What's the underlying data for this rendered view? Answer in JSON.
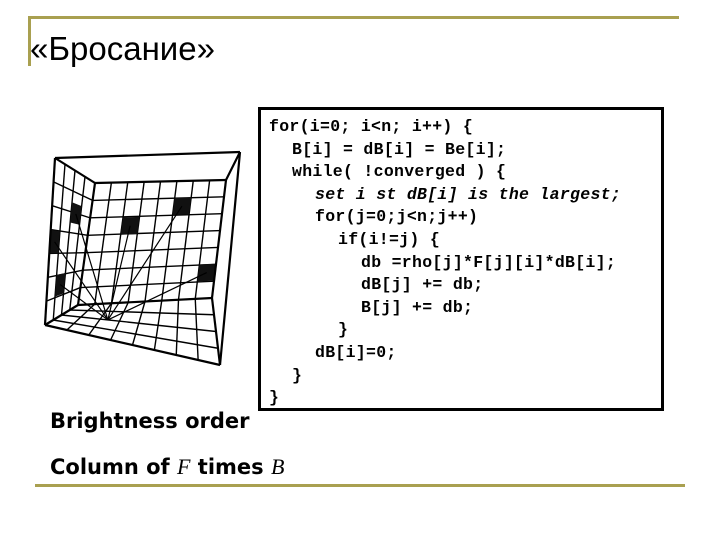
{
  "slide": {
    "title": "«Бросание»",
    "accent_color": "#a9a050"
  },
  "code": {
    "lines": [
      {
        "indent": 0,
        "text": "for(i=0; i<n; i++) {",
        "italic": false
      },
      {
        "indent": 1,
        "text": "B[i] = dB[i] = Be[i];",
        "italic": false
      },
      {
        "indent": 1,
        "text": "while( !converged ) {",
        "italic": false
      },
      {
        "indent": 2,
        "text": "set i st dB[i] is the largest;",
        "italic": true
      },
      {
        "indent": 2,
        "text": "for(j=0;j<n;j++)",
        "italic": false
      },
      {
        "indent": 3,
        "text": "if(i!=j) {",
        "italic": false
      },
      {
        "indent": 4,
        "text": "db =rho[j]*F[j][i]*dB[i];",
        "italic": false
      },
      {
        "indent": 4,
        "text": "dB[j] += db;",
        "italic": false
      },
      {
        "indent": 4,
        "text": "B[j] += db;",
        "italic": false
      },
      {
        "indent": 3,
        "text": "}",
        "italic": false
      },
      {
        "indent": 2,
        "text": "dB[i]=0;",
        "italic": false
      },
      {
        "indent": 1,
        "text": "}",
        "italic": false
      },
      {
        "indent": 0,
        "text": "}",
        "italic": false
      }
    ]
  },
  "illustration": {
    "description": "room-grid-with-shooting-patch",
    "icon": "room-patches-diagram"
  },
  "captions": {
    "line1": "Brightness order",
    "line2_prefix": "Column of ",
    "line2_var1": "F",
    "line2_mid": " times ",
    "line2_var2": "B"
  }
}
